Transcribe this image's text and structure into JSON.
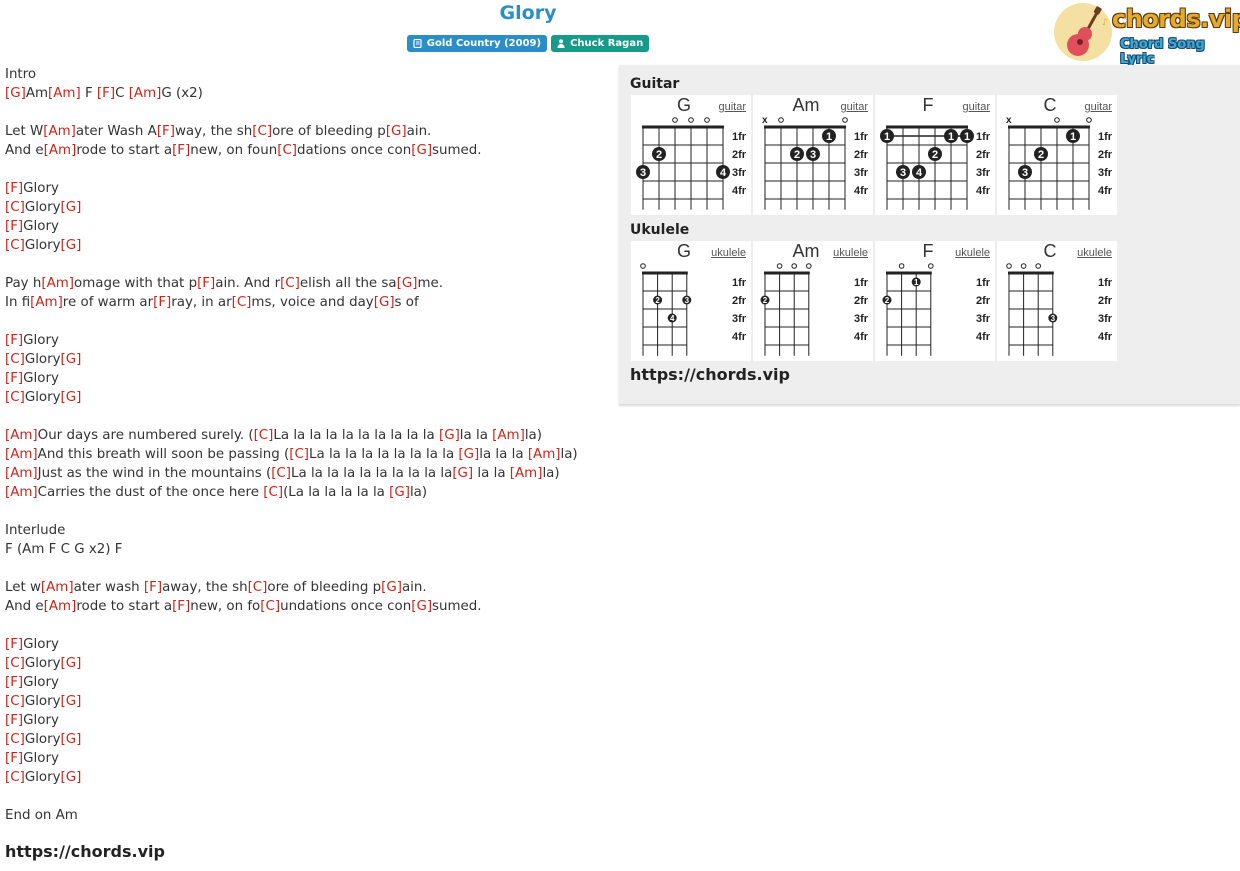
{
  "song": {
    "title": "Glory",
    "album": "Gold Country (2009)",
    "artist": "Chuck Ragan"
  },
  "logo": {
    "wordmark": "chords.vip",
    "tagline": "Chord Song Lyric"
  },
  "colors": {
    "chord": "#d0241a",
    "title": "#2a8fc8",
    "album_badge": "#2a8fc8",
    "artist_badge": "#169a8a"
  },
  "icons": {
    "album": "album-icon",
    "artist": "user-icon",
    "logo": "guitar-icon"
  },
  "lyrics": [
    [
      {
        "t": "Intro"
      }
    ],
    [
      {
        "c": "[G]"
      },
      {
        "t": "Am"
      },
      {
        "c": "[Am]"
      },
      {
        "t": " F "
      },
      {
        "c": "[F]"
      },
      {
        "t": "C "
      },
      {
        "c": "[Am]"
      },
      {
        "t": "G (x2)"
      }
    ],
    [],
    [
      {
        "t": "Let W"
      },
      {
        "c": "[Am]"
      },
      {
        "t": "ater Wash A"
      },
      {
        "c": "[F]"
      },
      {
        "t": "way, the sh"
      },
      {
        "c": "[C]"
      },
      {
        "t": "ore of bleeding p"
      },
      {
        "c": "[G]"
      },
      {
        "t": "ain."
      }
    ],
    [
      {
        "t": "And e"
      },
      {
        "c": "[Am]"
      },
      {
        "t": "rode to start a"
      },
      {
        "c": "[F]"
      },
      {
        "t": "new, on foun"
      },
      {
        "c": "[C]"
      },
      {
        "t": "dations once con"
      },
      {
        "c": "[G]"
      },
      {
        "t": "sumed."
      }
    ],
    [],
    [
      {
        "c": "[F]"
      },
      {
        "t": "Glory"
      }
    ],
    [
      {
        "c": "[C]"
      },
      {
        "t": "Glory"
      },
      {
        "c": "[G]"
      }
    ],
    [
      {
        "c": "[F]"
      },
      {
        "t": "Glory"
      }
    ],
    [
      {
        "c": "[C]"
      },
      {
        "t": "Glory"
      },
      {
        "c": "[G]"
      }
    ],
    [],
    [
      {
        "t": "Pay h"
      },
      {
        "c": "[Am]"
      },
      {
        "t": "omage with that p"
      },
      {
        "c": "[F]"
      },
      {
        "t": "ain. And r"
      },
      {
        "c": "[C]"
      },
      {
        "t": "elish all the sa"
      },
      {
        "c": "[G]"
      },
      {
        "t": "me."
      }
    ],
    [
      {
        "t": "In fi"
      },
      {
        "c": "[Am]"
      },
      {
        "t": "re of warm ar"
      },
      {
        "c": "[F]"
      },
      {
        "t": "ray, in ar"
      },
      {
        "c": "[C]"
      },
      {
        "t": "ms, voice and day"
      },
      {
        "c": "[G]"
      },
      {
        "t": "s of"
      }
    ],
    [],
    [
      {
        "c": "[F]"
      },
      {
        "t": "Glory"
      }
    ],
    [
      {
        "c": "[C]"
      },
      {
        "t": "Glory"
      },
      {
        "c": "[G]"
      }
    ],
    [
      {
        "c": "[F]"
      },
      {
        "t": "Glory"
      }
    ],
    [
      {
        "c": "[C]"
      },
      {
        "t": "Glory"
      },
      {
        "c": "[G]"
      }
    ],
    [],
    [
      {
        "c": "[Am]"
      },
      {
        "t": "Our days are numbered surely. ("
      },
      {
        "c": "[C]"
      },
      {
        "t": "La la la la la la la la la la "
      },
      {
        "c": "[G]"
      },
      {
        "t": "la la "
      },
      {
        "c": "[Am]"
      },
      {
        "t": "la)"
      }
    ],
    [
      {
        "c": "[Am]"
      },
      {
        "t": "And this breath will soon be passing ("
      },
      {
        "c": "[C]"
      },
      {
        "t": "La la la la la la la la la "
      },
      {
        "c": "[G]"
      },
      {
        "t": "la la la "
      },
      {
        "c": "[Am]"
      },
      {
        "t": "la)"
      }
    ],
    [
      {
        "c": "[Am]"
      },
      {
        "t": "Just as the wind in the mountains ("
      },
      {
        "c": "[C]"
      },
      {
        "t": "La la la la la la la la la la"
      },
      {
        "c": "[G]"
      },
      {
        "t": " la la "
      },
      {
        "c": "[Am]"
      },
      {
        "t": "la)"
      }
    ],
    [
      {
        "c": "[Am]"
      },
      {
        "t": "Carries the dust of the once here "
      },
      {
        "c": "[C]"
      },
      {
        "t": "(La la la la la la "
      },
      {
        "c": "[G]"
      },
      {
        "t": "la)"
      }
    ],
    [],
    [
      {
        "t": "Interlude"
      }
    ],
    [
      {
        "t": "F (Am F C G x2) F"
      }
    ],
    [],
    [
      {
        "t": "Let w"
      },
      {
        "c": "[Am]"
      },
      {
        "t": "ater wash "
      },
      {
        "c": "[F]"
      },
      {
        "t": "away, the sh"
      },
      {
        "c": "[C]"
      },
      {
        "t": "ore of bleeding p"
      },
      {
        "c": "[G]"
      },
      {
        "t": "ain."
      }
    ],
    [
      {
        "t": "And e"
      },
      {
        "c": "[Am]"
      },
      {
        "t": "rode to start a"
      },
      {
        "c": "[F]"
      },
      {
        "t": "new, on fo"
      },
      {
        "c": "[C]"
      },
      {
        "t": "undations once con"
      },
      {
        "c": "[G]"
      },
      {
        "t": "sumed."
      }
    ],
    [],
    [
      {
        "c": "[F]"
      },
      {
        "t": "Glory"
      }
    ],
    [
      {
        "c": "[C]"
      },
      {
        "t": "Glory"
      },
      {
        "c": "[G]"
      }
    ],
    [
      {
        "c": "[F]"
      },
      {
        "t": "Glory"
      }
    ],
    [
      {
        "c": "[C]"
      },
      {
        "t": "Glory"
      },
      {
        "c": "[G]"
      }
    ],
    [
      {
        "c": "[F]"
      },
      {
        "t": "Glory"
      }
    ],
    [
      {
        "c": "[C]"
      },
      {
        "t": "Glory"
      },
      {
        "c": "[G]"
      }
    ],
    [
      {
        "c": "[F]"
      },
      {
        "t": "Glory"
      }
    ],
    [
      {
        "c": "[C]"
      },
      {
        "t": "Glory"
      },
      {
        "c": "[G]"
      }
    ],
    [],
    [
      {
        "t": "End on Am"
      }
    ]
  ],
  "footer_link": "https://chords.vip",
  "chord_panel": {
    "guitar_heading": "Guitar",
    "ukulele_heading": "Ukulele",
    "link": "https://chords.vip",
    "fret_labels": [
      "1fr",
      "2fr",
      "3fr",
      "4fr"
    ],
    "guitar": [
      {
        "name": "G",
        "link": "guitar",
        "top": [
          "",
          "",
          "o",
          "o",
          "o",
          ""
        ],
        "dots": [
          {
            "s": 5,
            "f": 2,
            "n": "2"
          },
          {
            "s": 6,
            "f": 3,
            "n": "3"
          },
          {
            "s": 1,
            "f": 3,
            "n": "4"
          }
        ],
        "barre": null
      },
      {
        "name": "Am",
        "link": "guitar",
        "top": [
          "x",
          "o",
          "",
          "",
          "",
          "o"
        ],
        "dots": [
          {
            "s": 2,
            "f": 1,
            "n": "1"
          },
          {
            "s": 4,
            "f": 2,
            "n": "2"
          },
          {
            "s": 3,
            "f": 2,
            "n": "3"
          }
        ],
        "barre": null
      },
      {
        "name": "F",
        "link": "guitar",
        "top": [
          "",
          "",
          "",
          "",
          "",
          ""
        ],
        "dots": [
          {
            "s": 6,
            "f": 1,
            "n": "1"
          },
          {
            "s": 2,
            "f": 1,
            "n": "1"
          },
          {
            "s": 1,
            "f": 1,
            "n": "1"
          },
          {
            "s": 3,
            "f": 2,
            "n": "2"
          },
          {
            "s": 5,
            "f": 3,
            "n": "3"
          },
          {
            "s": 4,
            "f": 3,
            "n": "4"
          }
        ],
        "barre": 1
      },
      {
        "name": "C",
        "link": "guitar",
        "top": [
          "x",
          "",
          "",
          "o",
          "",
          "o"
        ],
        "dots": [
          {
            "s": 2,
            "f": 1,
            "n": "1"
          },
          {
            "s": 4,
            "f": 2,
            "n": "2"
          },
          {
            "s": 5,
            "f": 3,
            "n": "3"
          }
        ],
        "barre": null
      }
    ],
    "ukulele": [
      {
        "name": "G",
        "link": "ukulele",
        "top": [
          "o",
          "",
          "",
          ""
        ],
        "dots": [
          {
            "s": 3,
            "f": 2,
            "n": "2"
          },
          {
            "s": 1,
            "f": 2,
            "n": "3"
          },
          {
            "s": 2,
            "f": 3,
            "n": "4"
          }
        ]
      },
      {
        "name": "Am",
        "link": "ukulele",
        "top": [
          "",
          "o",
          "o",
          "o"
        ],
        "dots": [
          {
            "s": 4,
            "f": 2,
            "n": "2"
          }
        ]
      },
      {
        "name": "F",
        "link": "ukulele",
        "top": [
          "",
          "o",
          "",
          "o"
        ],
        "dots": [
          {
            "s": 4,
            "f": 2,
            "n": "2"
          },
          {
            "s": 2,
            "f": 1,
            "n": "1"
          }
        ]
      },
      {
        "name": "C",
        "link": "ukulele",
        "top": [
          "o",
          "o",
          "o",
          ""
        ],
        "dots": [
          {
            "s": 1,
            "f": 3,
            "n": "3"
          }
        ]
      }
    ]
  }
}
